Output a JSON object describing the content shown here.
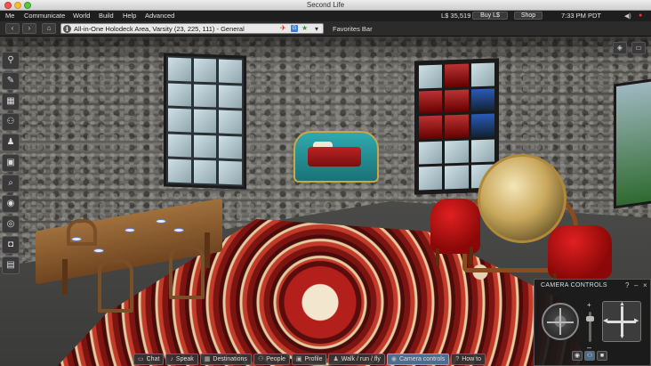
{
  "window": {
    "title": "Second Life"
  },
  "menu": {
    "items": [
      "Me",
      "Communicate",
      "World",
      "Build",
      "Help",
      "Advanced"
    ],
    "balance": "L$ 35,519",
    "buy_label": "Buy L$",
    "shop_label": "Shop",
    "clock": "7:33 PM PDT"
  },
  "nav": {
    "location": "All-in-One Holodeck Area, Varsity (23, 225, 111) - General",
    "rating_badge": "G",
    "favorites": "Favorites Bar"
  },
  "camera": {
    "title": "CAMERA CONTROLS",
    "help": "?",
    "minimize": "–",
    "close": "×"
  },
  "bottom_bar": [
    {
      "icon": "chat-icon",
      "label": "Chat",
      "active": false
    },
    {
      "icon": "speak-icon",
      "label": "Speak",
      "active": false
    },
    {
      "icon": "destinations-icon",
      "label": "Destinations",
      "active": false
    },
    {
      "icon": "people-icon",
      "label": "People",
      "active": false
    },
    {
      "icon": "profile-icon",
      "label": "Profile",
      "active": false
    },
    {
      "icon": "walk-icon",
      "label": "Walk / run / fly",
      "active": false
    },
    {
      "icon": "camera-icon",
      "label": "Camera controls",
      "active": true
    },
    {
      "icon": "howto-icon",
      "label": "How to",
      "active": false
    }
  ],
  "left_toolbar": [
    "appearance-icon",
    "build-icon",
    "map-icon",
    "people-icon",
    "avatar-icon",
    "inventory-icon",
    "search-icon",
    "places-icon",
    "voice-icon",
    "snapshot-icon",
    "chat-history-icon"
  ],
  "colors": {
    "accent": "#4d6d8e",
    "rating": "#3a7fd5"
  }
}
